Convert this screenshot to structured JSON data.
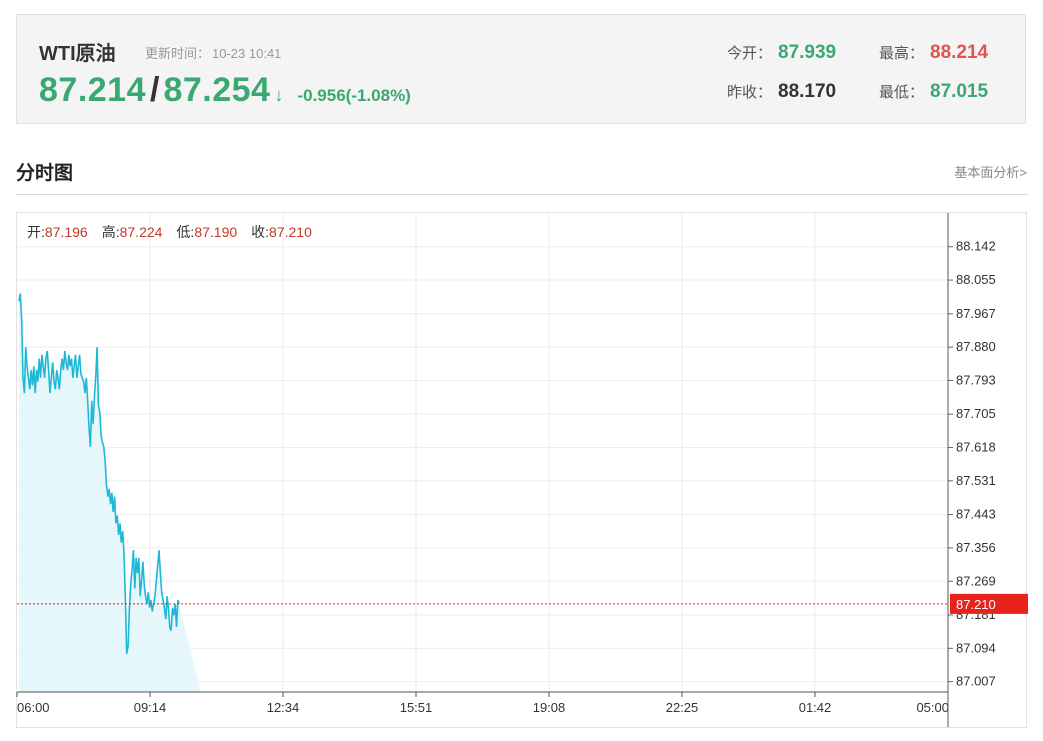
{
  "quote": {
    "title": "WTI原油",
    "update_label": "更新时间：",
    "update_time": "10-23 10:41",
    "bid": "87.214",
    "separator": "/",
    "ask": "87.254",
    "arrow": "↓",
    "change": "-0.956(-1.08%)",
    "open_label": "今开：",
    "open": "87.939",
    "prev_close_label": "昨收：",
    "prev_close": "88.170",
    "high_label": "最高：",
    "high": "88.214",
    "low_label": "最低：",
    "low": "87.015",
    "color_down": "#3aa871",
    "color_up": "#e05552"
  },
  "section": {
    "title": "分时图",
    "link": "基本面分析>"
  },
  "ohlc": {
    "open_label": "开:",
    "open": "87.196",
    "high_label": "高:",
    "high": "87.224",
    "low_label": "低:",
    "low": "87.190",
    "close_label": "收:",
    "close": "87.210"
  },
  "chart_data": {
    "type": "area",
    "x_ticks": [
      "06:00",
      "09:14",
      "12:34",
      "15:51",
      "19:08",
      "22:25",
      "01:42",
      "05:00"
    ],
    "y_ticks": [
      "88.142",
      "88.055",
      "87.967",
      "87.880",
      "87.793",
      "87.705",
      "87.618",
      "87.531",
      "87.443",
      "87.356",
      "87.269",
      "87.181",
      "87.094",
      "87.007"
    ],
    "ylim": [
      86.98,
      88.23
    ],
    "current_price": "87.210",
    "current_value": 87.21,
    "line_color": "#1eb8d6",
    "fill_color": "#e6f7fb",
    "current_color": "#e8231b",
    "x_label_at_end": "05:00",
    "series": [
      {
        "x_minutes": [
          0,
          2,
          4,
          6,
          8,
          10,
          12,
          14,
          16,
          18,
          20,
          22,
          24,
          26,
          28,
          30,
          32,
          34,
          36,
          38,
          40,
          42,
          44,
          46,
          48,
          50,
          52,
          54,
          56,
          58,
          60,
          62,
          64,
          66,
          68,
          70,
          72,
          74,
          76,
          78,
          80,
          82,
          84,
          86,
          88,
          90,
          92,
          94,
          96,
          98,
          100,
          102,
          104,
          106,
          108,
          110,
          112,
          114,
          116,
          118,
          120,
          122,
          124,
          126,
          128,
          130,
          132,
          134,
          136,
          138,
          140,
          142,
          144,
          146,
          148,
          150,
          152,
          154,
          156,
          158,
          160,
          162,
          164,
          166,
          168,
          170,
          172,
          174,
          176,
          178,
          180,
          182,
          184,
          186,
          188,
          190,
          192,
          194,
          196,
          198,
          200,
          202,
          204,
          206,
          208,
          210,
          212,
          214,
          216,
          218,
          220,
          222,
          224,
          226,
          228,
          230,
          232,
          234,
          236,
          238,
          240,
          242,
          244,
          246,
          248,
          250,
          252,
          254,
          256,
          258,
          260,
          262,
          264,
          266,
          268,
          270
        ],
        "values": [
          88.0,
          88.02,
          87.95,
          87.8,
          87.76,
          87.88,
          87.83,
          87.8,
          87.77,
          87.82,
          87.78,
          87.83,
          87.76,
          87.82,
          87.79,
          87.85,
          87.8,
          87.86,
          87.83,
          87.8,
          87.85,
          87.87,
          87.82,
          87.76,
          87.8,
          87.84,
          87.79,
          87.77,
          87.82,
          87.8,
          87.77,
          87.82,
          87.85,
          87.82,
          87.87,
          87.84,
          87.82,
          87.86,
          87.83,
          87.85,
          87.8,
          87.83,
          87.86,
          87.8,
          87.83,
          87.86,
          87.81,
          87.8,
          87.79,
          87.76,
          87.8,
          87.74,
          87.67,
          87.62,
          87.74,
          87.68,
          87.75,
          87.8,
          87.88,
          87.73,
          87.71,
          87.65,
          87.63,
          87.62,
          87.58,
          87.52,
          87.49,
          87.51,
          87.47,
          87.5,
          87.45,
          87.49,
          87.42,
          87.44,
          87.39,
          87.42,
          87.37,
          87.4,
          87.34,
          87.22,
          87.08,
          87.1,
          87.2,
          87.26,
          87.3,
          87.35,
          87.25,
          87.33,
          87.29,
          87.33,
          87.23,
          87.27,
          87.32,
          87.26,
          87.23,
          87.21,
          87.24,
          87.2,
          87.22,
          87.19,
          87.21,
          87.23,
          87.27,
          87.31,
          87.35,
          87.29,
          87.24,
          87.22,
          87.2,
          87.17,
          87.23,
          87.2,
          87.15,
          87.14,
          87.2,
          87.18,
          87.21,
          87.15,
          87.22,
          87.21
        ]
      }
    ]
  }
}
